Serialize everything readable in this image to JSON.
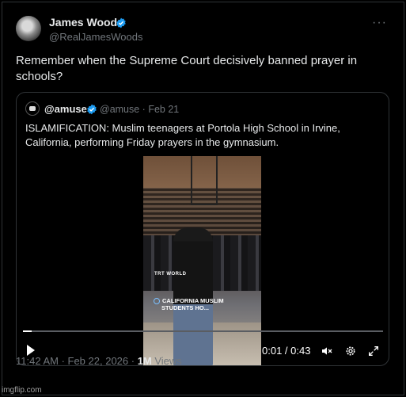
{
  "author": {
    "name": "James Woods",
    "handle": "@RealJamesWoods"
  },
  "more": "···",
  "tweet_text": "Remember when the Supreme Court decisively banned prayer in schools?",
  "quote": {
    "name": "@amuse",
    "meta": "@amuse · Feb 21",
    "text": "ISLAMIFICATION: Muslim teenagers at Portola High School in Irvine, California, performing Friday prayers in the gymnasium.",
    "video": {
      "watermark": "TRT WORLD",
      "caption_line1": "CALIFORNIA MUSLIM",
      "caption_line2": "STUDENTS HO...",
      "time": "0:01 / 0:43",
      "progress_fraction": 0.025
    }
  },
  "footer": {
    "time": "11:42 AM · Feb 22, 2026 · ",
    "views_count": "1M",
    "views_label": " Views"
  },
  "credit": "imgflip.com",
  "colors": {
    "verified": "#1d9bf0",
    "muted": "#71767b",
    "text": "#e7e9ea",
    "border": "#2f3336"
  }
}
